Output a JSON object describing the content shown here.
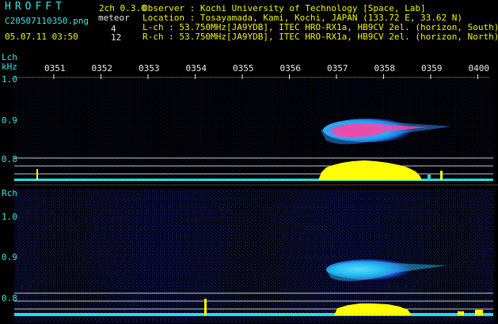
{
  "header": {
    "title": "HROFFT",
    "mode": "2ch 0.3.0",
    "filename": "C20507110350.png",
    "meteor_label": "meteor",
    "count_l": "4",
    "count_r": "12",
    "datetime": "05.07.11 03:50",
    "observer": "Observer : Kochi University of Technology [Space, Lab]",
    "location": "Location : Tosayamada, Kami, Kochi, JAPAN (133.72 E, 33.62 N)",
    "lch_info": "L-ch : 53.750MHz[JA9YDB], ITEC HRO-RX1a, HB9CV 2el. (horizon, South)",
    "rch_info": "R-ch : 53.750MHz[JA9YDB], ITEC HRO-RX1a, HB9CV 2el. (horizon, North)"
  },
  "lch": {
    "label": "Lch",
    "unit": "kHz",
    "ticks": [
      "1.0",
      "0.9",
      "0.8"
    ]
  },
  "rch": {
    "label": "Rch",
    "ticks": [
      "1.0",
      "0.9",
      "0.8"
    ]
  },
  "time_axis": [
    "0351",
    "0352",
    "0353",
    "0354",
    "0355",
    "0356",
    "0357",
    "0358",
    "0359",
    "0400"
  ],
  "colors": {
    "background": "#000000",
    "text_cyan": "#35e8e8",
    "text_yellow": "#f4f400",
    "echo_yellow": "#ffff00",
    "noise_blue": "#1a2aa0",
    "echo_hot": "#ff3d9a"
  }
}
